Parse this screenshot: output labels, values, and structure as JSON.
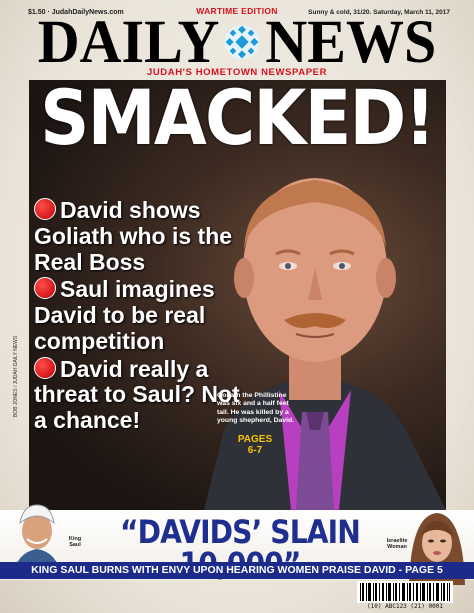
{
  "header": {
    "price_site": "$1.50 · JudahDailyNews.com",
    "edition": "WARTIME EDITION",
    "weather_date": "Sunny & cold, 31/20. Saturday, March 11, 2017",
    "masthead_left": "DAILY",
    "masthead_right": "NEWS",
    "tagline": "JUDAH'S HOMETOWN NEWSPAPER"
  },
  "cover": {
    "headline": "SMACKED!",
    "bullets": [
      "David shows Goliath who is the Real Boss",
      "Saul imagines David to be real competition",
      "David really a threat to Saul? Not a chance!"
    ],
    "caption": "Goliath the Phillistine was six and a half feet tall. He was killed by a young shepherd, David.",
    "pages_label": "PAGES",
    "pages_range": "6-7",
    "photo_credit": "BOB JONES / JUDAH DAILY NEWS"
  },
  "bottom": {
    "quote": "“DAVIDS’ SLAIN 10,000”",
    "subline": "KING SAUL BURNS WITH ENVY UPON HEARING WOMEN PRAISE DAVID - PAGE 5",
    "king_label": "King Saul",
    "woman_label": "Israelite Woman",
    "barcode_text": "(10) ABC123 (21) 0001"
  },
  "colors": {
    "accent_red": "#d6121f",
    "quote_blue": "#1f2f8f",
    "band_blue": "#1c2b8a",
    "pages_yellow": "#f7c400"
  }
}
